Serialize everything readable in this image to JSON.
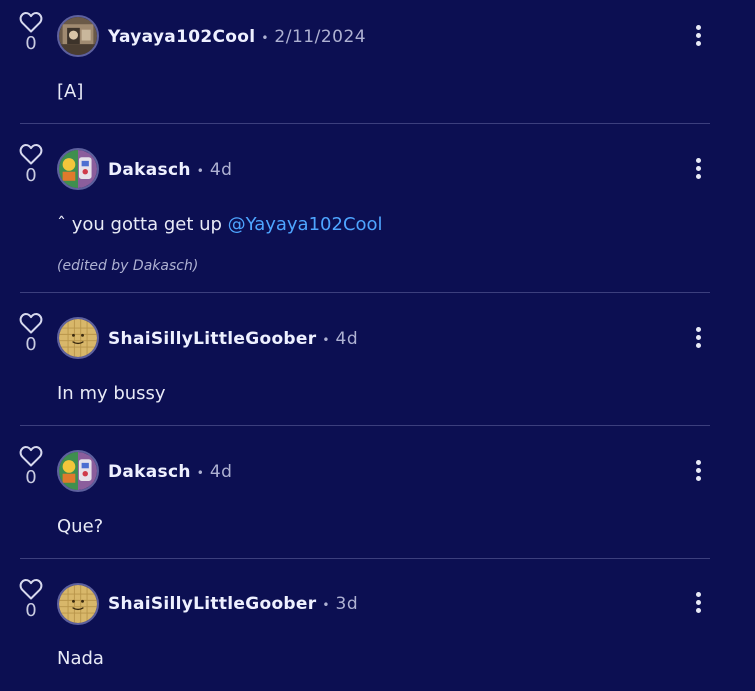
{
  "colors": {
    "background": "#0c0f52",
    "text": "#e8eaf6",
    "muted": "#aeb1d2",
    "mention": "#4ea5ff",
    "divider": "#3c3f7d"
  },
  "separator": "•",
  "comments": [
    {
      "username": "Yayaya102Cool",
      "timestamp": "2/11/2024",
      "likes": "0",
      "text": "[A]",
      "avatar_icon": "photo-avatar-icon"
    },
    {
      "username": "Dakasch",
      "timestamp": "4d",
      "likes": "0",
      "text": "ˆ you gotta get up",
      "mention": "@Yayaya102Cool",
      "edited_note": "(edited by Dakasch)",
      "avatar_icon": "collage-avatar-icon"
    },
    {
      "username": "ShaiSillyLittleGoober",
      "timestamp": "4d",
      "likes": "0",
      "text": "In my bussy",
      "avatar_icon": "smiley-avatar-icon"
    },
    {
      "username": "Dakasch",
      "timestamp": "4d",
      "likes": "0",
      "text": "Que?",
      "avatar_icon": "collage-avatar-icon"
    },
    {
      "username": "ShaiSillyLittleGoober",
      "timestamp": "3d",
      "likes": "0",
      "text": "Nada",
      "avatar_icon": "smiley-avatar-icon"
    }
  ]
}
